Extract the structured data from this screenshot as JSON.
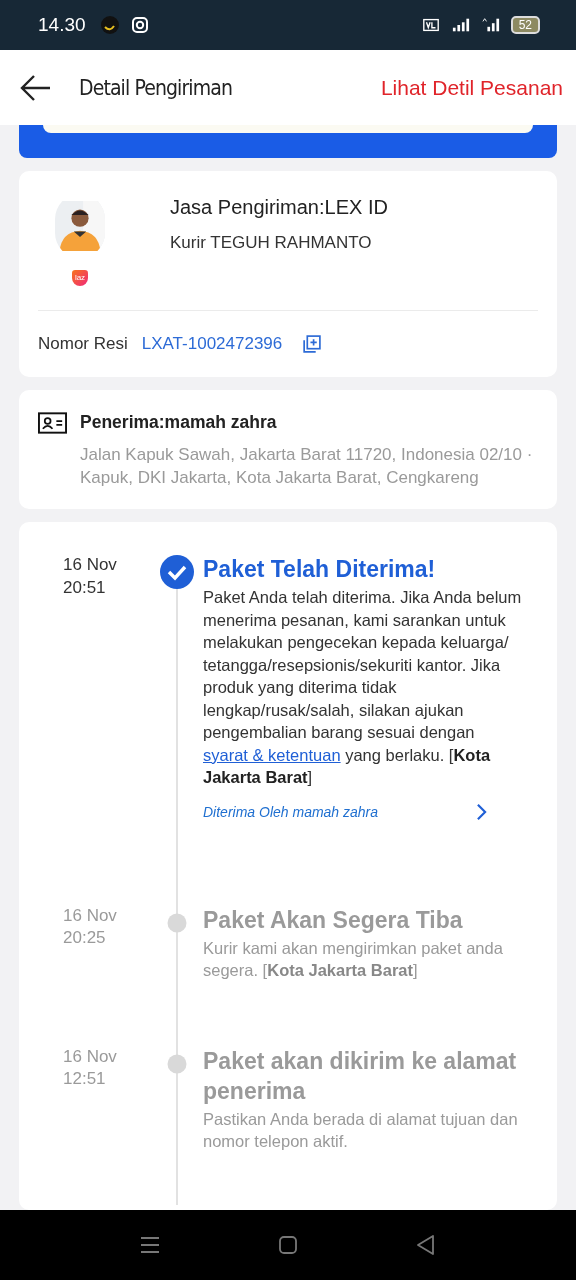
{
  "status_bar": {
    "time": "14.30",
    "battery": "52"
  },
  "header": {
    "title": "Detail Pengiriman",
    "action": "Lihat Detil Pesanan"
  },
  "courier": {
    "logo_text": "laz",
    "service": "Jasa Pengiriman:LEX ID",
    "courier_name": "Kurir TEGUH RAHMANTO",
    "tracking_label": "Nomor Resi",
    "tracking_number": "LXAT-1002472396"
  },
  "recipient": {
    "name": "Penerima:mamah zahra",
    "address": "Jalan Kapuk Sawah, Jakarta Barat 11720, Indonesia 02/10 · Kapuk, DKI Jakarta, Kota Jakarta Barat, Cengkareng"
  },
  "timeline": [
    {
      "date": "16 Nov",
      "time": "20:51",
      "active": true,
      "title": "Paket Telah Diterima!",
      "body": [
        {
          "kind": "text",
          "text": "Paket Anda telah diterima. Jika Anda belum menerima pesanan, kami sarankan untuk melakukan pengecekan kepada keluarga/ tetangga/resepsionis/sekuriti kantor. Jika produk yang diterima tidak lengkap/rusak/salah, silakan ajukan pengembalian barang sesuai dengan "
        },
        {
          "kind": "link",
          "text": "syarat & ketentuan"
        },
        {
          "kind": "text",
          "text": " yang berlaku. [**Kota Jakarta Barat**]"
        }
      ],
      "receiver": "Diterima Oleh mamah zahra"
    },
    {
      "date": "16 Nov",
      "time": "20:25",
      "active": false,
      "title": "Paket Akan Segera Tiba",
      "body": [
        {
          "kind": "text",
          "text": "Kurir kami akan mengirimkan paket anda segera. [**Kota Jakarta Barat**]"
        }
      ]
    },
    {
      "date": "16 Nov",
      "time": "12:51",
      "active": false,
      "title": "Paket akan dikirim ke alamat penerima",
      "body": [
        {
          "kind": "text",
          "text": "Pastikan Anda berada di alamat tujuan dan nomor telepon aktif."
        }
      ]
    }
  ]
}
